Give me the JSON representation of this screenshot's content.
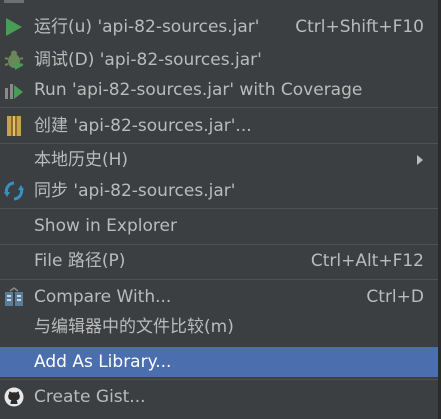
{
  "menu": {
    "run": {
      "label": "运行(u) 'api-82-sources.jar'",
      "shortcut": "Ctrl+Shift+F10",
      "icon": "run-icon"
    },
    "debug": {
      "label": "调试(D) 'api-82-sources.jar'",
      "icon": "debug-icon"
    },
    "coverage": {
      "label": "Run 'api-82-sources.jar' with Coverage",
      "icon": "coverage-icon"
    },
    "create": {
      "label": "创建 'api-82-sources.jar'...",
      "icon": "create-config-icon"
    },
    "local_history": {
      "label": "本地历史(H)"
    },
    "sync": {
      "label": "同步 'api-82-sources.jar'",
      "icon": "sync-icon"
    },
    "show_in_explorer": {
      "label": "Show in Explorer"
    },
    "file_path": {
      "label": "File 路径(P)",
      "shortcut": "Ctrl+Alt+F12"
    },
    "compare_with": {
      "label": "Compare With...",
      "shortcut": "Ctrl+D",
      "icon": "compare-icon"
    },
    "compare_editor": {
      "label": "与编辑器中的文件比较(m)"
    },
    "add_as_library": {
      "label": "Add As Library..."
    },
    "create_gist": {
      "label": "Create Gist...",
      "icon": "github-icon"
    }
  },
  "colors": {
    "background": "#3c3f41",
    "text": "#bbbbbb",
    "selection": "#4b6eaf",
    "separator": "#515151",
    "run_green": "#499c54",
    "sync_blue": "#3592c4"
  }
}
